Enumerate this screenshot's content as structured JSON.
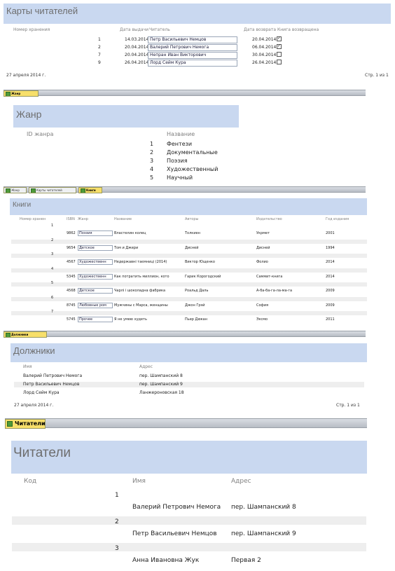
{
  "cards": {
    "title": "Карты читателей",
    "headers": {
      "storage": "Номер хранения",
      "issue_date": "Дата выдачи",
      "reader": "Читатель",
      "return_date": "Дата возврата",
      "book_returned": "Книга возвращена"
    },
    "rows": [
      {
        "num": "1",
        "issue": "14.03.2014",
        "reader": "Петр Васильевич Немцов",
        "ret": "20.04.2014",
        "checked": true
      },
      {
        "num": "2",
        "issue": "20.04.2014",
        "reader": "Валерий Петрович Немога",
        "ret": "06.04.2014",
        "checked": true
      },
      {
        "num": "7",
        "issue": "20.04.2014",
        "reader": "Непран Иван Викторович",
        "ret": "30.04.2014",
        "checked": false
      },
      {
        "num": "9",
        "issue": "26.04.2014",
        "reader": "Лорд Сейм Кура",
        "ret": "26.04.2014",
        "checked": false
      }
    ],
    "footer_date": "27 апреля 2014 г.",
    "footer_page": "Стр. 1 из 1"
  },
  "tabs1": [
    {
      "label": "Жанр",
      "active": true
    }
  ],
  "genre": {
    "title": "Жанр",
    "col_id": "ID жанра",
    "col_name": "Название",
    "rows": [
      {
        "id": "1",
        "name": "Фентези"
      },
      {
        "id": "2",
        "name": "Документальные"
      },
      {
        "id": "3",
        "name": "Поэзия"
      },
      {
        "id": "4",
        "name": "Художественный"
      },
      {
        "id": "5",
        "name": "Научный"
      }
    ]
  },
  "tabs2": [
    {
      "label": "Жанр",
      "active": false
    },
    {
      "label": "Карты читателей",
      "active": false
    },
    {
      "label": "Книги",
      "active": true
    }
  ],
  "books": {
    "title": "Книги",
    "headers": {
      "storage": "Номер хранен",
      "isbn": "ISBN",
      "genre": "Жанр",
      "name": "Название",
      "authors": "Авторы",
      "publisher": "Издательство",
      "year": "Год издания"
    },
    "rows": [
      {
        "num": "1",
        "isbn": "9862",
        "genre": "Поэзия",
        "name": "Властелин колец",
        "author": "Толкиен",
        "publisher": "Укрмет",
        "year": "2001"
      },
      {
        "num": "2",
        "isbn": "9654",
        "genre": "Детское",
        "name": "Том и Джери",
        "author": "Дисней",
        "publisher": "Дисней",
        "year": "1994"
      },
      {
        "num": "3",
        "isbn": "4567",
        "genre": "Художественн",
        "name": "Недержавні таємниці (2014)",
        "author": "Виктор Ющенко",
        "publisher": "Фолио",
        "year": "2014"
      },
      {
        "num": "4",
        "isbn": "5345",
        "genre": "Художественн",
        "name": "Как потратить миллион, кото",
        "author": "Гарик Корогодский",
        "publisher": "Саммит-книга",
        "year": "2014"
      },
      {
        "num": "5",
        "isbn": "4568",
        "genre": "Детское",
        "name": "Чарлі і шоколадна фабрика",
        "author": "Роальд Даль",
        "publisher": "А-ба-ба-га-ла-ма-га",
        "year": "2009"
      },
      {
        "num": "6",
        "isbn": "8745",
        "genre": "Любовные ром",
        "name": "Мужчины с Марса, женщины",
        "author": "Джон Грэй",
        "publisher": "София",
        "year": "2009"
      },
      {
        "num": "7",
        "isbn": "5745",
        "genre": "Прочее",
        "name": "Я не умею худеть",
        "author": "Пьер Дюкан",
        "publisher": "Эксмо",
        "year": "2011"
      }
    ]
  },
  "tabs3": [
    {
      "label": "Должники",
      "active": true
    }
  ],
  "debtors": {
    "title": "Должники",
    "col_name": "Имя",
    "col_address": "Адрес",
    "rows": [
      {
        "name": "Валерий Петрович Немога",
        "address": "пер. Шампанский 8"
      },
      {
        "name": "Петр Васильевич Немцов",
        "address": "пер. Шампанский 9"
      },
      {
        "name": "Лорд Сейм Кура",
        "address": "Ланжероновская 18"
      }
    ],
    "footer_date": "27 апреля 2014 г.",
    "footer_page": "Стр. 1 из 1"
  },
  "tabs4": [
    {
      "label": "Читатели",
      "active": true
    }
  ],
  "readers": {
    "title": "Читатели",
    "col_code": "Код",
    "col_name": "Имя",
    "col_address": "Адрес",
    "rows": [
      {
        "code": "1",
        "name": "Валерий Петрович Немога",
        "address": "пер. Шампанский 8"
      },
      {
        "code": "2",
        "name": "Петр Васильевич Немцов",
        "address": "пер. Шампанский 9"
      },
      {
        "code": "3",
        "name": "Анна Ивановна Жук",
        "address": "Первая 2"
      }
    ]
  }
}
